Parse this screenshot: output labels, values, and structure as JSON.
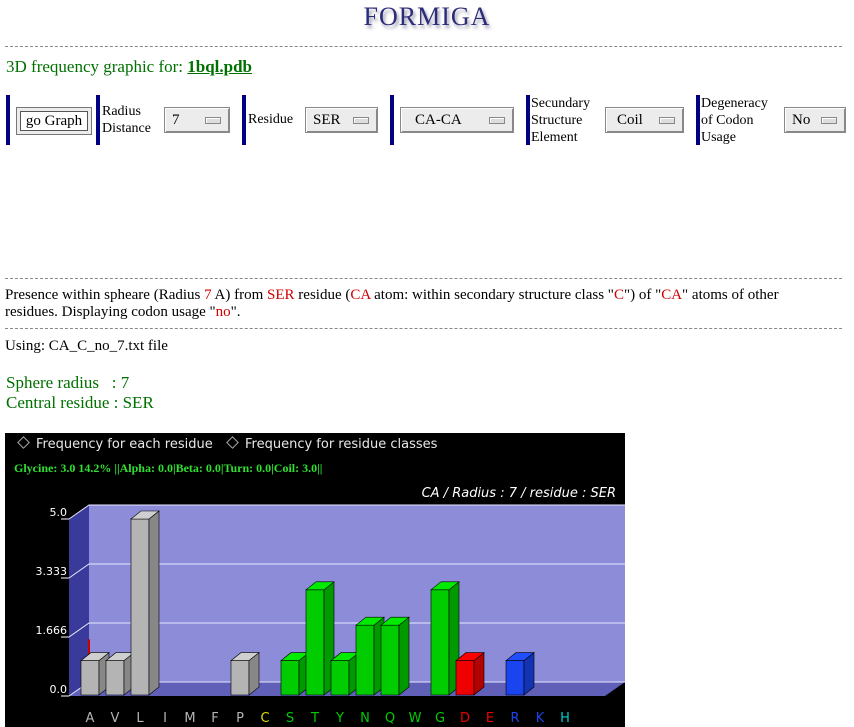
{
  "logo": "FORMIGA",
  "title": {
    "prefix": "3D frequency graphic for:",
    "file": "1bql.pdb"
  },
  "controls": {
    "go_button": "go Graph",
    "radius_label": "Radius Distance",
    "radius_label_1": "Radius",
    "radius_label_2": "Distance",
    "radius_value": "7",
    "residue_label": "Residue",
    "residue_value": "SER",
    "atom_value": "CA-CA",
    "sse_label_1": "Secundary",
    "sse_label_2": "Structure",
    "sse_label_3": "Element",
    "sse_value": "Coil",
    "deg_label_1": "Degeneracy",
    "deg_label_2": "of Codon",
    "deg_label_3": "Usage",
    "deg_value": "No"
  },
  "description": {
    "t1": "Presence within spheare (Radius ",
    "r1": "7",
    "t2": " A) from ",
    "r2": "SER",
    "t3": " residue (",
    "r3": "CA",
    "t4": " atom: within secondary structure class \"",
    "r4": "C",
    "t5": "\") of \"",
    "r5": "CA",
    "t6": "\" atoms of other residues. Displaying codon usage \"",
    "r6": "no",
    "t7": "\"."
  },
  "using": "Using: CA_C_no_7.txt file",
  "info": {
    "sphere_radius": "Sphere radius   : 7",
    "central_residue": "Central residue : SER"
  },
  "applet": {
    "radio1": "Frequency for each residue",
    "radio2": "Frequency for residue classes",
    "status": "Glycine: 3.0  14.2%  ||Alpha: 0.0|Beta: 0.0|Turn: 0.0|Coil: 3.0||",
    "chart_title": "CA / Radius : 7 / residue : SER"
  },
  "colors": {
    "gray": "#b4b4b4",
    "green": "#00cc00",
    "red": "#ee0000",
    "blue": "#1a44ee",
    "plot_bg": "#8c8cd8",
    "floor": "#6060b8"
  },
  "chart_data": {
    "type": "bar",
    "title": "CA / Radius : 7 / residue : SER",
    "yticks": [
      "0.0",
      "1.666",
      "3.333",
      "5.0"
    ],
    "ylim": [
      0,
      5
    ],
    "categories": [
      "A",
      "V",
      "L",
      "I",
      "M",
      "F",
      "P",
      "C",
      "S",
      "T",
      "Y",
      "N",
      "Q",
      "W",
      "G",
      "D",
      "E",
      "R",
      "K",
      "H"
    ],
    "values": [
      1.0,
      1.0,
      5.0,
      0,
      0,
      0,
      1.0,
      0,
      1.0,
      3.0,
      1.0,
      2.0,
      2.0,
      0,
      3.0,
      1.0,
      0,
      1.0,
      0,
      0
    ],
    "label_colors": [
      "#b4b4b4",
      "#b4b4b4",
      "#b4b4b4",
      "#b4b4b4",
      "#b4b4b4",
      "#b4b4b4",
      "#b4b4b4",
      "#dddd00",
      "#00cc00",
      "#00cc00",
      "#00cc00",
      "#00cc00",
      "#00cc00",
      "#00cc00",
      "#00cc00",
      "#ee0000",
      "#ee0000",
      "#1a44ee",
      "#1a44ee",
      "#00cccc"
    ],
    "bar_colors": [
      "#b4b4b4",
      "#b4b4b4",
      "#b4b4b4",
      "#b4b4b4",
      "#b4b4b4",
      "#b4b4b4",
      "#b4b4b4",
      "#dddd00",
      "#00cc00",
      "#00cc00",
      "#00cc00",
      "#00cc00",
      "#00cc00",
      "#00cc00",
      "#00cc00",
      "#ee0000",
      "#ee0000",
      "#1a44ee",
      "#1a44ee",
      "#00cccc"
    ]
  }
}
